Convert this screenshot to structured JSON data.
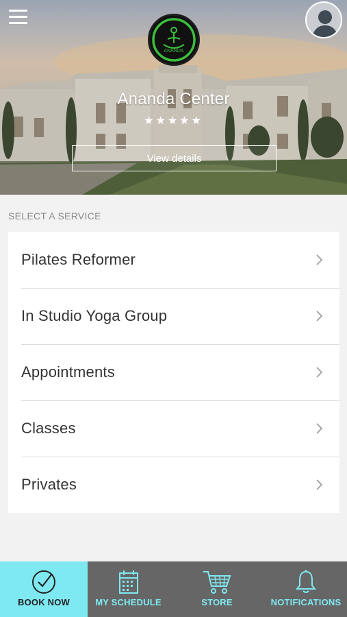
{
  "header": {
    "center_name": "Ananda Center",
    "rating": "★★★★★",
    "view_details_label": "View details",
    "logo_text": "ANANDA"
  },
  "services": {
    "section_label": "SELECT A SERVICE",
    "items": [
      {
        "label": "Pilates Reformer"
      },
      {
        "label": "In Studio Yoga Group"
      },
      {
        "label": "Appointments"
      },
      {
        "label": "Classes"
      },
      {
        "label": "Privates"
      }
    ]
  },
  "tabbar": {
    "tabs": [
      {
        "label": "BOOK NOW",
        "icon": "check-circle-icon",
        "active": true
      },
      {
        "label": "MY SCHEDULE",
        "icon": "calendar-icon",
        "active": false
      },
      {
        "label": "STORE",
        "icon": "cart-icon",
        "active": false
      },
      {
        "label": "NOTIFICATIONS",
        "icon": "bell-icon",
        "active": false
      }
    ]
  },
  "colors": {
    "accent": "#7fe9f2",
    "tabbar_bg": "#666666",
    "logo_green": "#3cbf3c",
    "page_bg": "#f2f2f2"
  }
}
